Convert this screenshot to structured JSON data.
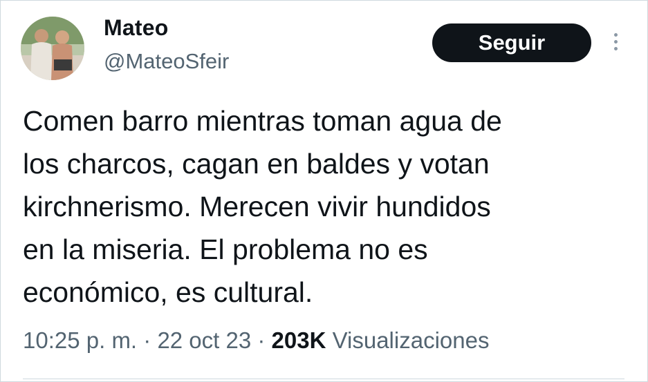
{
  "author": {
    "display_name": "Mateo",
    "handle": "@MateoSfeir"
  },
  "actions": {
    "follow_label": "Seguir"
  },
  "tweet": {
    "lines": [
      "Comen barro mientras toman agua de",
      "los charcos, cagan en baldes y votan",
      "kirchnerismo. Merecen vivir hundidos",
      "en la miseria. El problema no es",
      "económico, es cultural."
    ]
  },
  "meta": {
    "time": "10:25 p. m.",
    "separator": " · ",
    "date": "22 oct 23",
    "views_count": "203K",
    "views_label": " Visualizaciones"
  },
  "colors": {
    "text": "#0f1419",
    "secondary": "#536471",
    "button_bg": "#0f1419",
    "button_text": "#ffffff"
  }
}
